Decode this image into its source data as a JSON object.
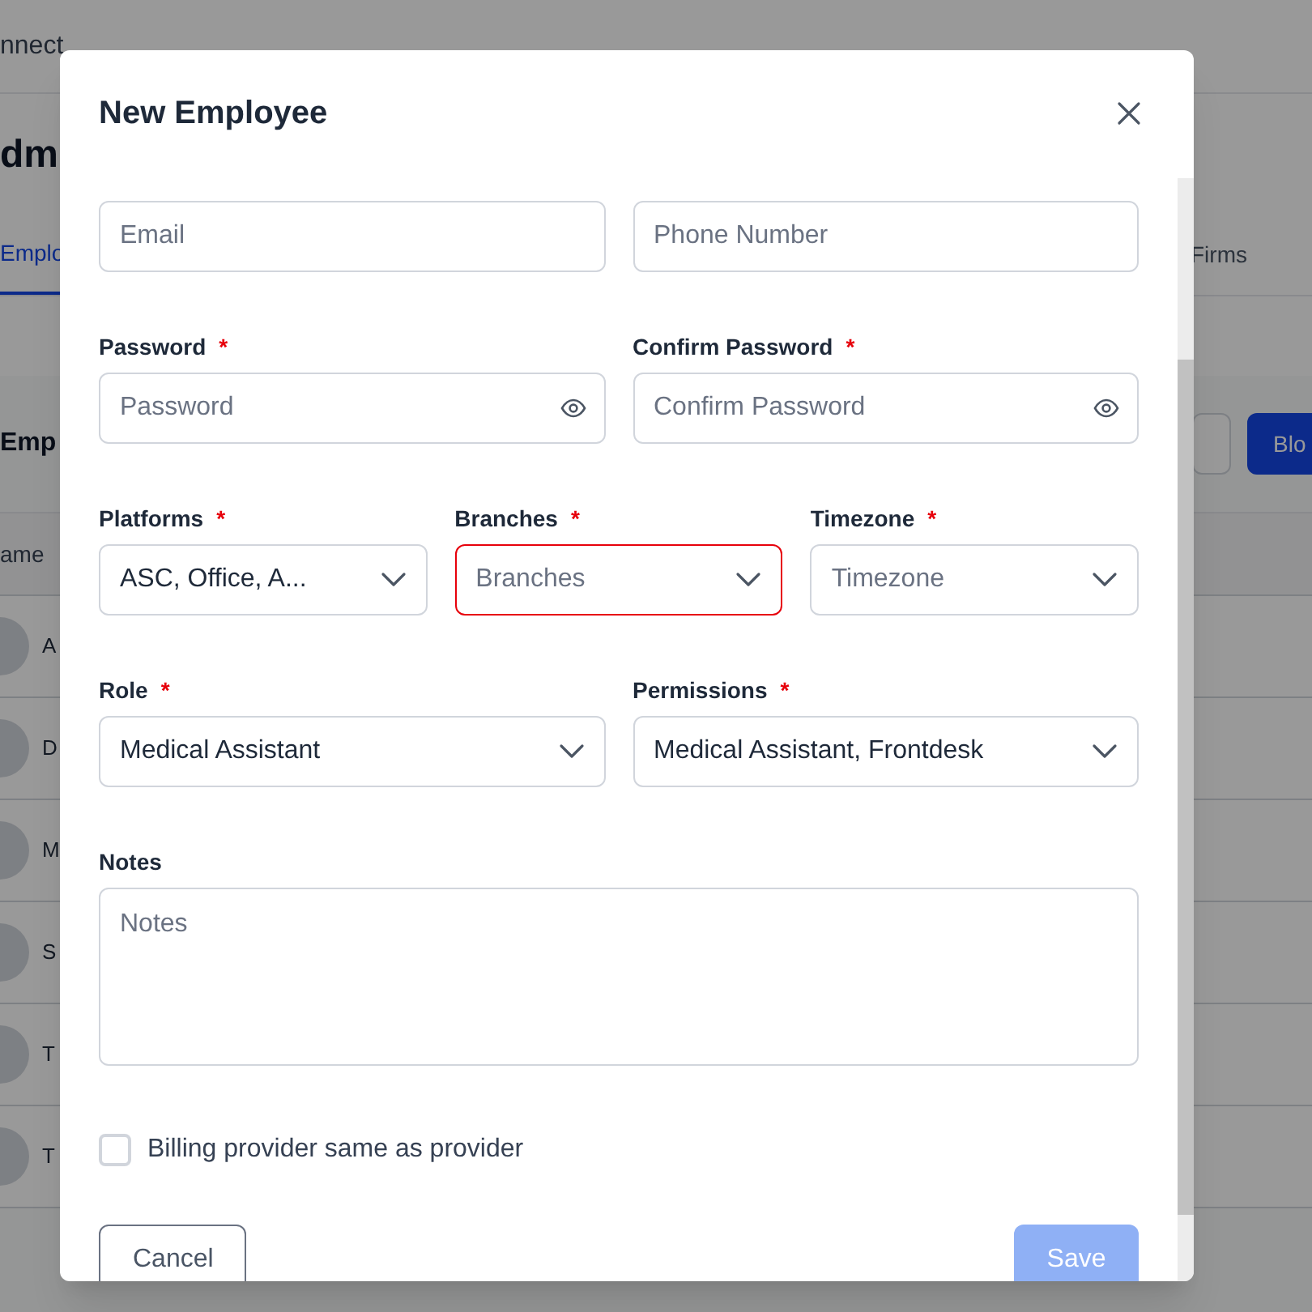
{
  "background": {
    "app_name": "nnect",
    "heading": "dm",
    "tabs": [
      {
        "label": "Emplo",
        "selected": true
      },
      {
        "label": "Firms",
        "selected": false
      }
    ],
    "section_title": "Emp",
    "action_button": "Blo",
    "table": {
      "column_header": "ame",
      "rows": [
        "A",
        "D",
        "M",
        "S",
        "T",
        "T"
      ]
    }
  },
  "dialog": {
    "title": "New Employee",
    "rows": [
      [
        {
          "kind": "text",
          "placeholder": "Email"
        },
        {
          "kind": "text",
          "placeholder": "Phone Number"
        }
      ],
      [
        {
          "kind": "password",
          "label": "Password",
          "required_mark": "*",
          "placeholder": "Password"
        },
        {
          "kind": "password",
          "label": "Confirm Password",
          "required_mark": "*",
          "placeholder": "Confirm Password"
        }
      ],
      [
        {
          "kind": "select",
          "label": "Platforms",
          "required_mark": "*",
          "value": "ASC, Office, A...",
          "invalid": false
        },
        {
          "kind": "select",
          "label": "Branches",
          "required_mark": "*",
          "placeholder": "Branches",
          "invalid": true
        },
        {
          "kind": "select",
          "label": "Timezone",
          "required_mark": "*",
          "placeholder": "Timezone",
          "invalid": false
        }
      ],
      [
        {
          "kind": "select",
          "label": "Role",
          "required_mark": "*",
          "value": "Medical Assistant",
          "invalid": false
        },
        {
          "kind": "select",
          "label": "Permissions",
          "required_mark": "*",
          "value": "Medical Assistant, Frontdesk",
          "invalid": false
        }
      ]
    ],
    "notes": {
      "label": "Notes",
      "placeholder": "Notes"
    },
    "checkbox": {
      "label": "Billing provider same as provider",
      "checked": false
    },
    "buttons": [
      {
        "kind": "secondary",
        "label": "Cancel",
        "disabled": false
      },
      {
        "kind": "primary",
        "label": "Save",
        "disabled": true
      }
    ]
  }
}
